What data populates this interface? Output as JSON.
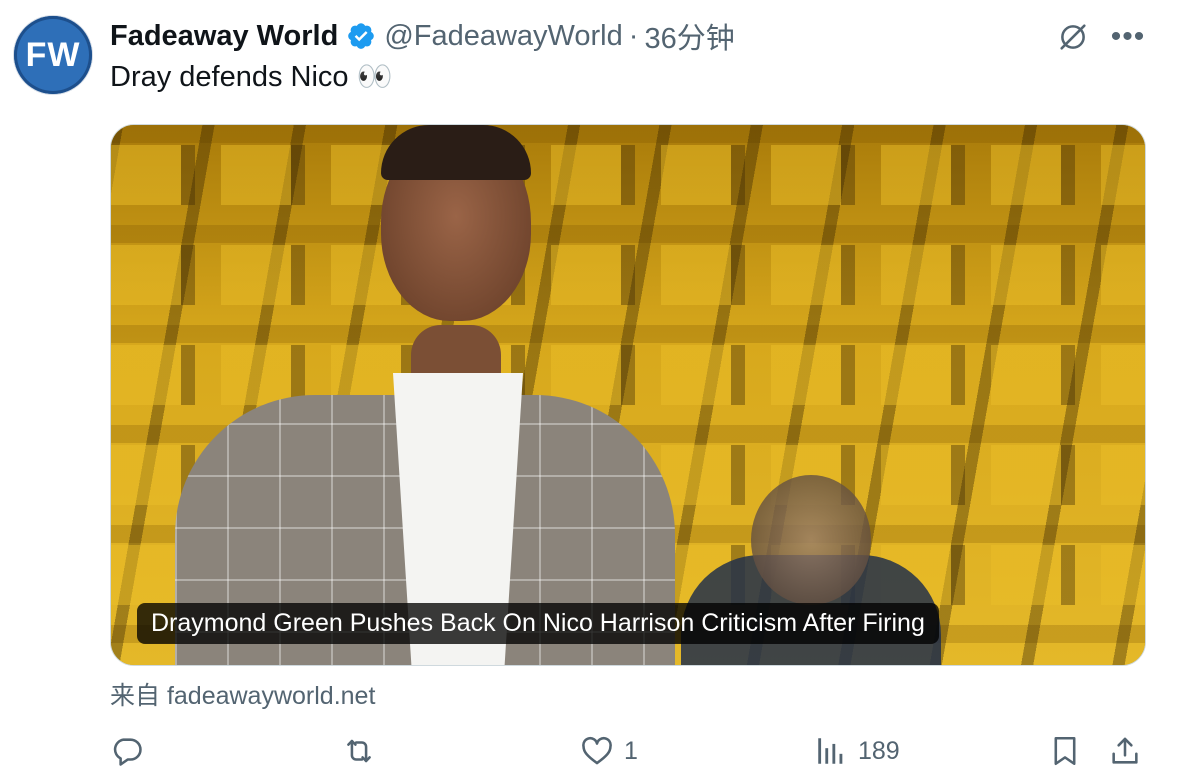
{
  "author": {
    "avatar_text": "FW",
    "display_name": "Fadeaway World",
    "handle": "@FadeawayWorld",
    "separator": "·",
    "time": "36分钟",
    "verified": true
  },
  "tweet": {
    "text": "Dray defends Nico 👀"
  },
  "card": {
    "headline": "Draymond Green Pushes Back On Nico Harrison Criticism After Firing",
    "source": "来自 fadeawayworld.net"
  },
  "actions": {
    "reply_icon": "reply-icon",
    "repost_icon": "repost-icon",
    "like_icon": "heart-icon",
    "like_count": "1",
    "views_icon": "views-icon",
    "view_count": "189",
    "bookmark_icon": "bookmark-icon",
    "share_icon": "share-icon"
  },
  "colors": {
    "text_primary": "#0f1419",
    "text_secondary": "#536471",
    "verified_blue": "#1d9bf0",
    "avatar_blue": "#2e6fb8"
  }
}
